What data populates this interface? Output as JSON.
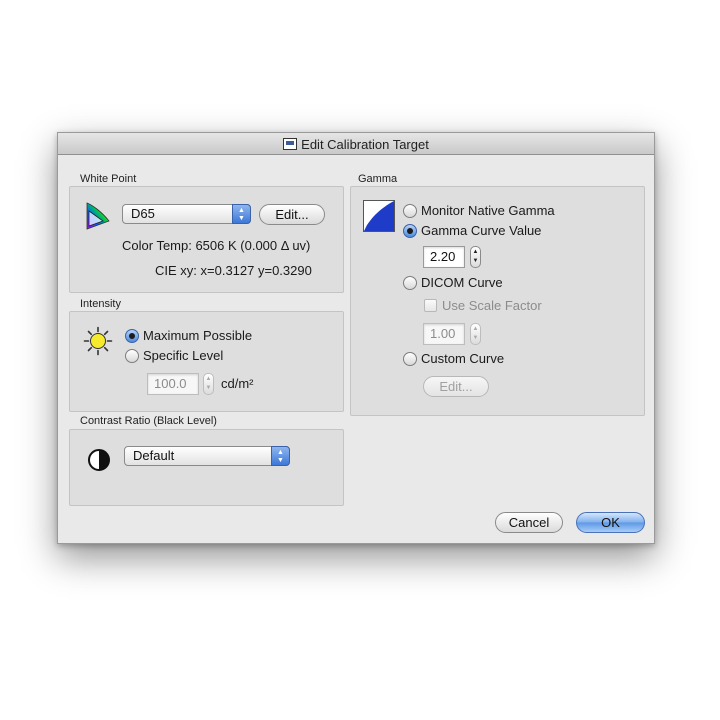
{
  "window": {
    "title": "Edit Calibration Target"
  },
  "white_point": {
    "label": "White Point",
    "icon": "cie-gamut-icon",
    "popup_value": "D65",
    "edit_button": "Edit...",
    "color_temp": "Color Temp: 6506 K (0.000 Δ uv)",
    "cie_xy": "CIE xy: x=0.3127 y=0.3290"
  },
  "intensity": {
    "label": "Intensity",
    "icon": "sun-icon",
    "options": [
      "Maximum Possible",
      "Specific Level"
    ],
    "selected": "Maximum Possible",
    "level_value": "100.0",
    "unit": "cd/m²"
  },
  "contrast": {
    "label": "Contrast Ratio (Black Level)",
    "icon": "contrast-icon",
    "popup_value": "Default"
  },
  "gamma": {
    "label": "Gamma",
    "icon": "gamma-curve-icon",
    "options": {
      "native": "Monitor Native Gamma",
      "curve_value": "Gamma Curve Value",
      "dicom": "DICOM Curve",
      "custom": "Custom Curve"
    },
    "selected": "Gamma Curve Value",
    "gamma_value": "2.20",
    "use_scale_factor": "Use Scale Factor",
    "scale_value": "1.00",
    "edit_button": "Edit..."
  },
  "buttons": {
    "cancel": "Cancel",
    "ok": "OK"
  },
  "colors": {
    "accent": "#4c8be0",
    "window_bg": "#e9e9e9",
    "group_bg": "#dedede"
  }
}
